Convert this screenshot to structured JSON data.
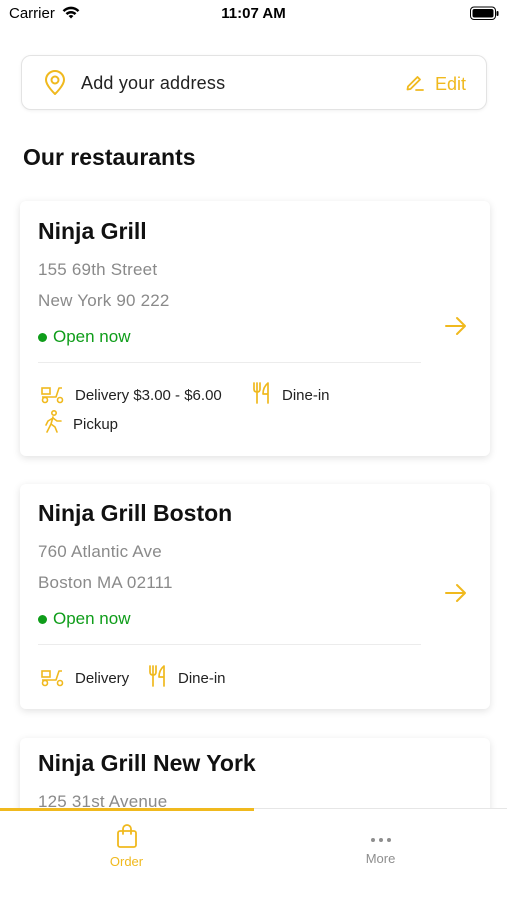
{
  "status_bar": {
    "carrier": "Carrier",
    "time": "11:07 AM"
  },
  "address": {
    "placeholder_text": "Add your address",
    "edit_label": "Edit"
  },
  "section_title": "Our restaurants",
  "restaurants": [
    {
      "name": "Ninja Grill",
      "address_line1": "155 69th Street",
      "address_line2": "New York 90 222",
      "status": "Open now",
      "services": {
        "delivery": "Delivery $3.00 - $6.00",
        "dine_in": "Dine-in",
        "pickup": "Pickup"
      }
    },
    {
      "name": "Ninja Grill Boston",
      "address_line1": "760 Atlantic Ave",
      "address_line2": "Boston MA 02111",
      "status": "Open now",
      "services": {
        "delivery": "Delivery",
        "dine_in": "Dine-in"
      }
    },
    {
      "name": "Ninja Grill New York",
      "address_line1": "125 31st Avenue"
    }
  ],
  "tabs": {
    "order": "Order",
    "more": "More"
  },
  "colors": {
    "accent": "#f0b91e",
    "open_green": "#0f9d1a",
    "secondary_text": "#8a8a8a"
  },
  "icons": [
    "wifi-icon",
    "battery-icon",
    "location-pin-icon",
    "edit-pencil-icon",
    "arrow-right-icon",
    "scooter-icon",
    "cutlery-icon",
    "walking-icon",
    "shopping-bag-icon",
    "more-dots-icon"
  ]
}
